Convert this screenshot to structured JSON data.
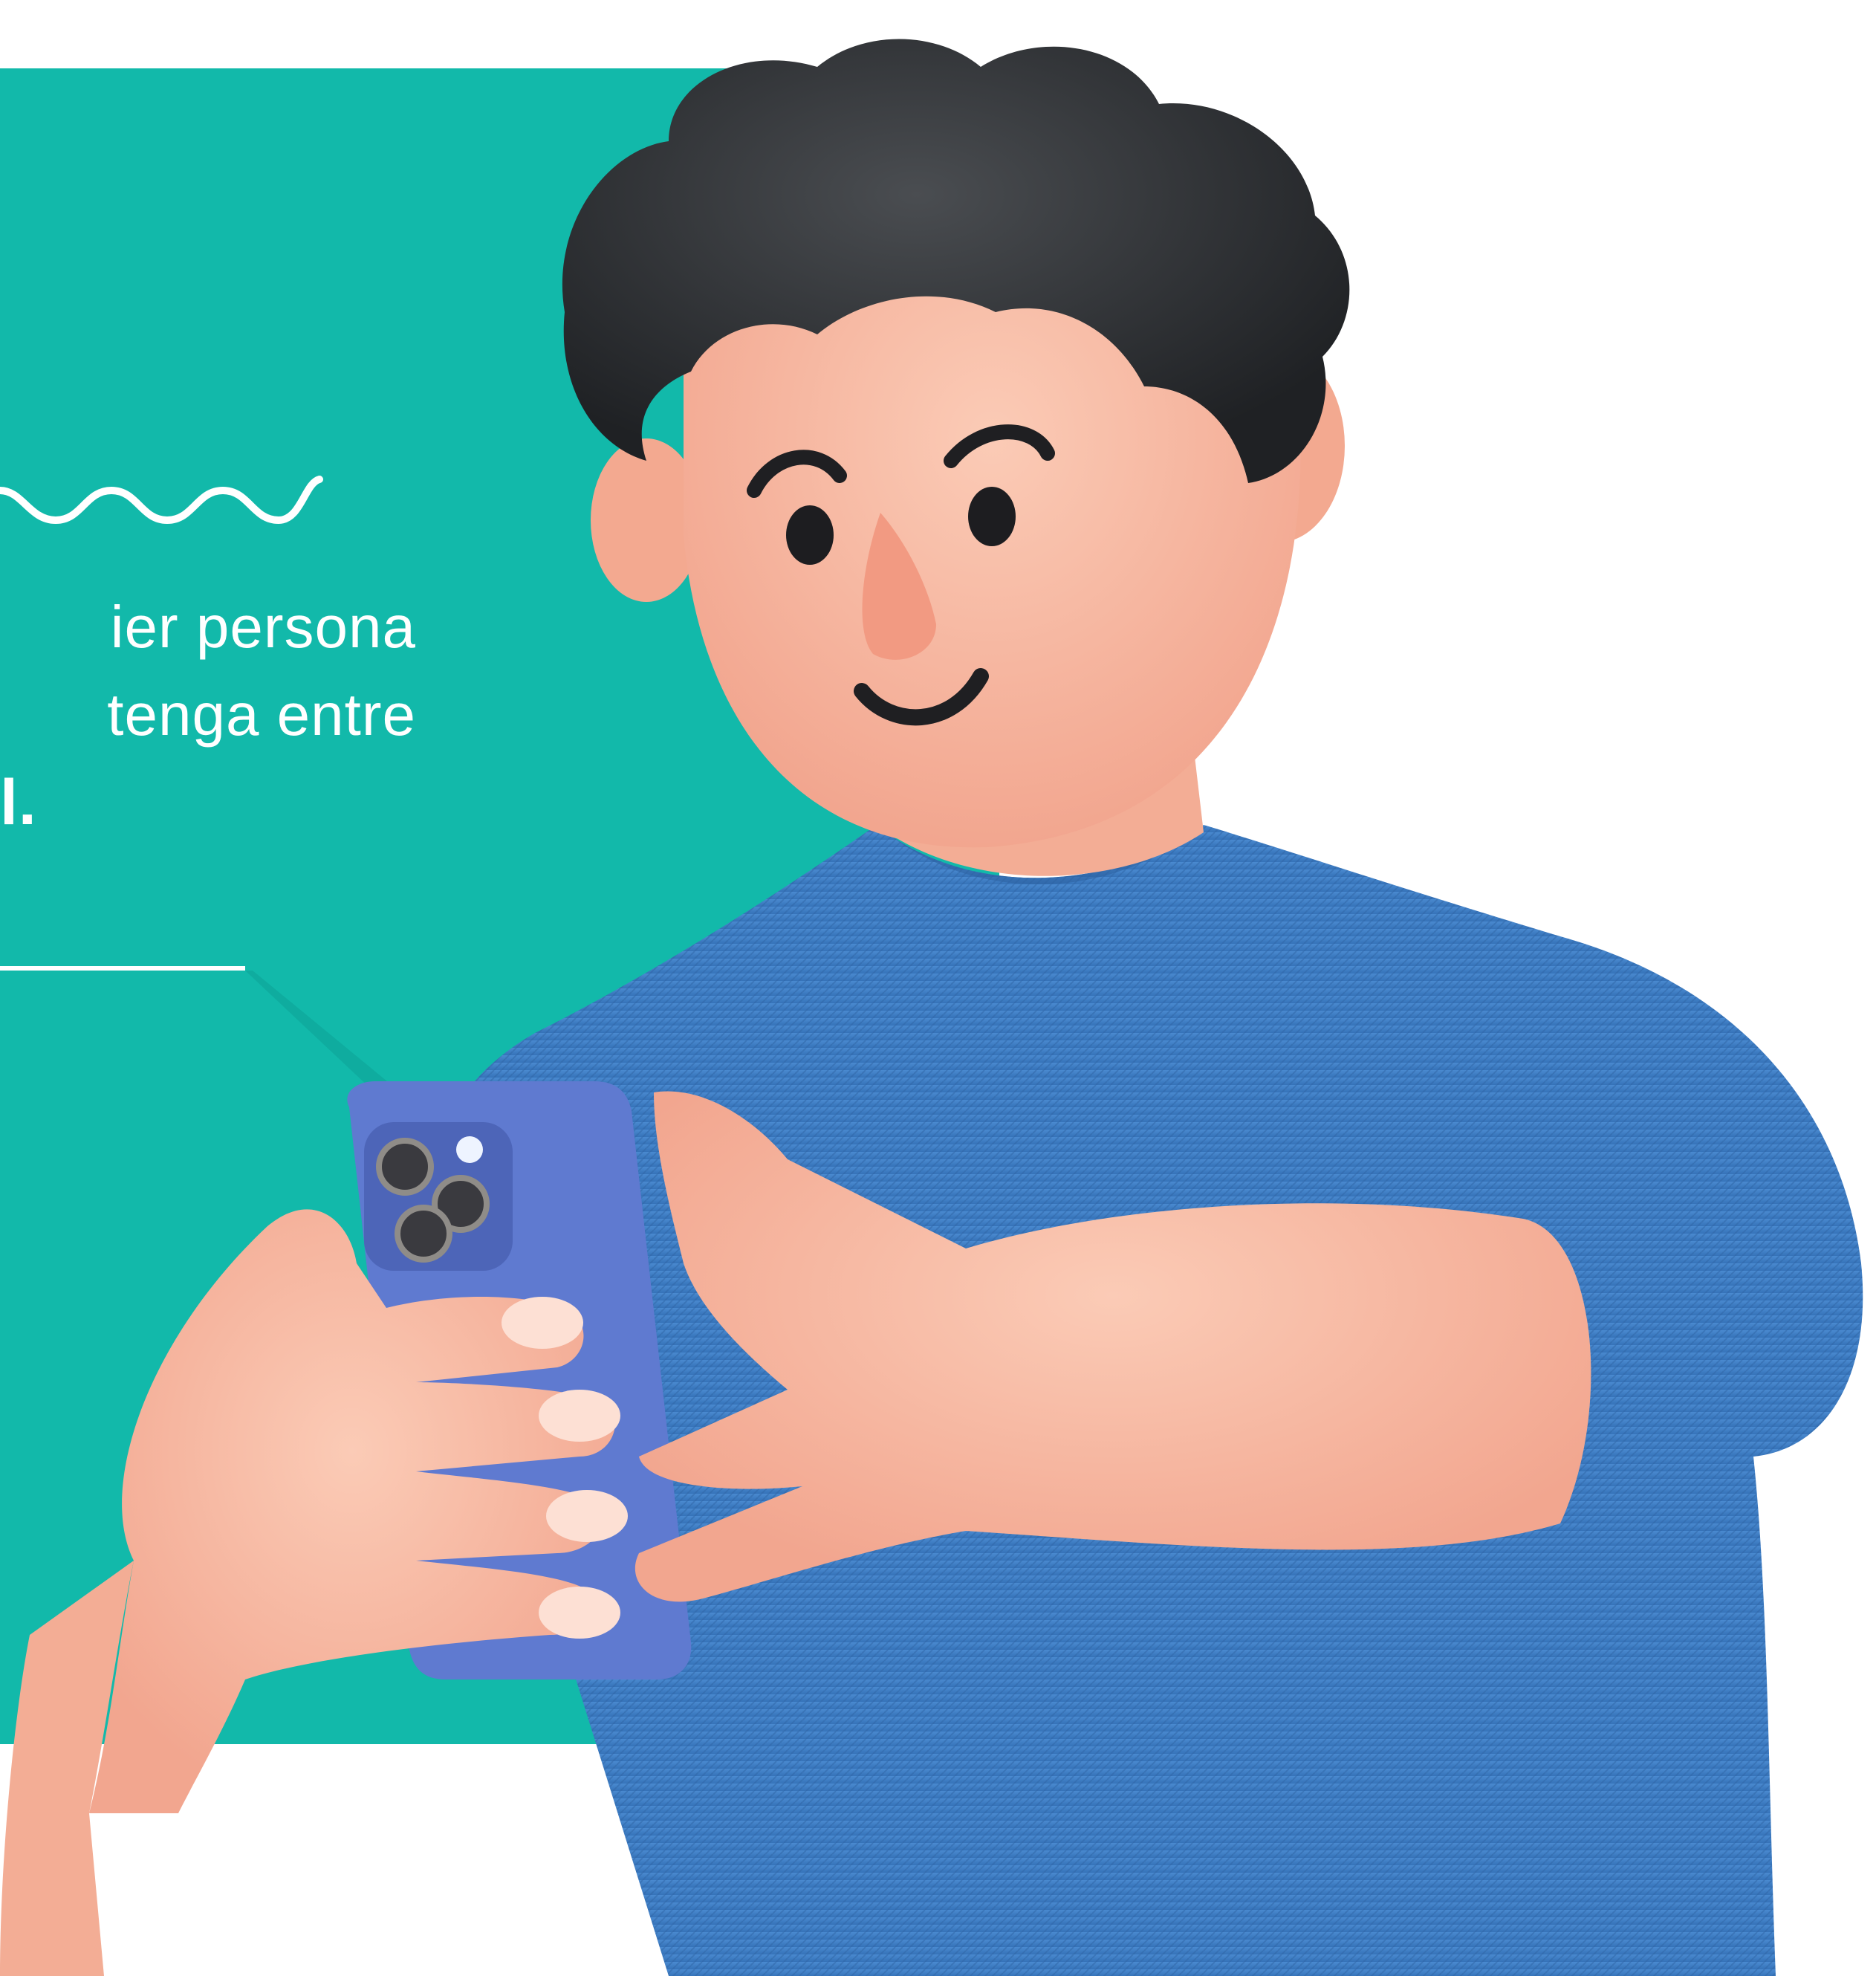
{
  "panel": {
    "color": "#12b9aa",
    "text_lines": [
      "ier persona",
      "tenga entre",
      "l."
    ]
  },
  "illustration": {
    "subject": "3d-character-using-phone",
    "shirt_color": "#3f7fc6",
    "skin_color": "#f7b9a3",
    "hair_color": "#2e3134",
    "phone_color": "#5f7ad0"
  }
}
